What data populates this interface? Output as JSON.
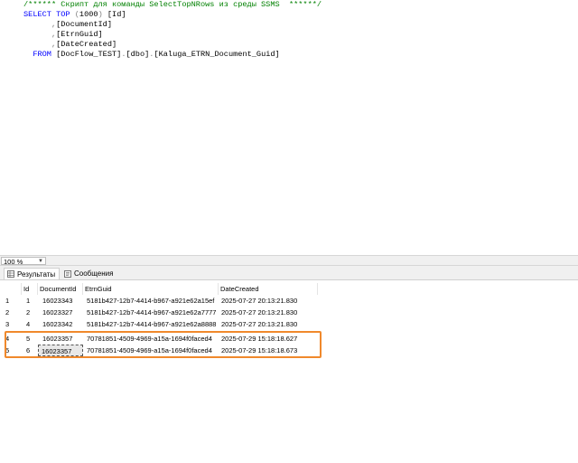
{
  "editor": {
    "lines": [
      {
        "segments": [
          {
            "t": "/****** Скрипт для команды SelectTopNRows из среды SSMS  ******/",
            "c": "cm"
          }
        ]
      },
      {
        "segments": [
          {
            "t": "SELECT ",
            "c": "kw"
          },
          {
            "t": "TOP ",
            "c": "kw"
          },
          {
            "t": "(",
            "c": "gray"
          },
          {
            "t": "1000",
            "c": "txt"
          },
          {
            "t": ") ",
            "c": "gray"
          },
          {
            "t": "[Id]",
            "c": "txt"
          }
        ]
      },
      {
        "segments": [
          {
            "t": "      ,",
            "c": "gray"
          },
          {
            "t": "[DocumentId]",
            "c": "txt"
          }
        ]
      },
      {
        "segments": [
          {
            "t": "      ,",
            "c": "gray"
          },
          {
            "t": "[EtrnGuid]",
            "c": "txt"
          }
        ]
      },
      {
        "segments": [
          {
            "t": "      ,",
            "c": "gray"
          },
          {
            "t": "[DateCreated]",
            "c": "txt"
          }
        ]
      },
      {
        "segments": [
          {
            "t": "  FROM ",
            "c": "kw"
          },
          {
            "t": "[DocFlow_TEST]",
            "c": "txt"
          },
          {
            "t": ".",
            "c": "gray"
          },
          {
            "t": "[dbo]",
            "c": "txt"
          },
          {
            "t": ".",
            "c": "gray"
          },
          {
            "t": "[Kaluga_ETRN_Document_Guid]",
            "c": "txt"
          }
        ]
      }
    ]
  },
  "zoom": {
    "value": "100 %"
  },
  "tabs": [
    {
      "label": "Результаты",
      "icon": "grid-icon",
      "active": true
    },
    {
      "label": "Сообщения",
      "icon": "messages-icon",
      "active": false
    }
  ],
  "grid": {
    "columns": [
      "Id",
      "DocumentId",
      "EtrnGuid",
      "DateCreated"
    ],
    "rows": [
      {
        "n": "1",
        "cells": [
          "1",
          "16023343",
          "5181b427-12b7-4414-b967-a921e62a15ef",
          "2025-07-27 20:13:21.830"
        ]
      },
      {
        "n": "2",
        "cells": [
          "2",
          "16023327",
          "5181b427-12b7-4414-b967-a921e62a7777",
          "2025-07-27 20:13:21.830"
        ]
      },
      {
        "n": "3",
        "cells": [
          "4",
          "16023342",
          "5181b427-12b7-4414-b967-a921e62a8888",
          "2025-07-27 20:13:21.830"
        ]
      },
      {
        "n": "4",
        "cells": [
          "5",
          "16023357",
          "70781851-4509-4969-a15a-1694f0faced4",
          "2025-07-29 15:18:18.627"
        ]
      },
      {
        "n": "5",
        "cells": [
          "6",
          "16023357",
          "70781851-4509-4969-a15a-1694f0faced4",
          "2025-07-29 15:18:18.673"
        ]
      }
    ],
    "highlight_color": "#f0892c"
  }
}
